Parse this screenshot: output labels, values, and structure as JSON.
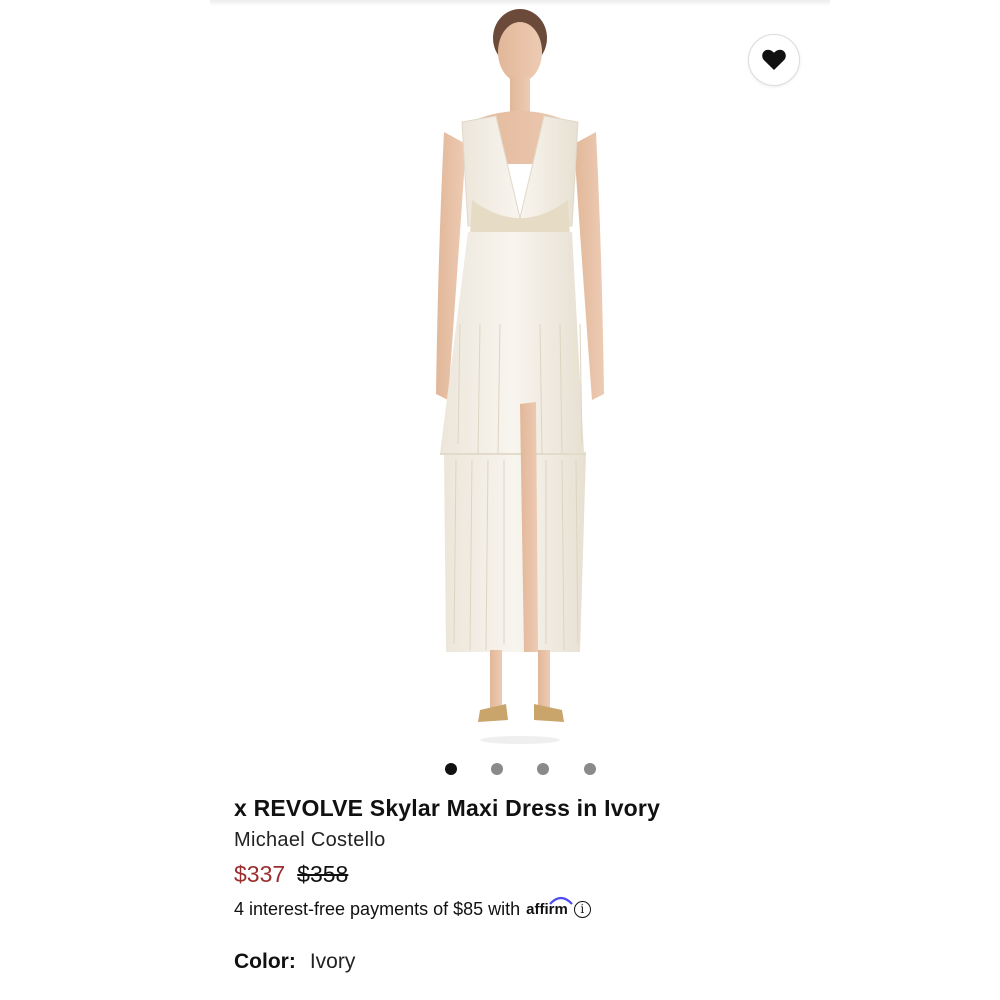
{
  "product": {
    "title": "x REVOLVE Skylar Maxi Dress in Ivory",
    "brand": "Michael Costello",
    "price_sale": "$337",
    "price_original": "$358",
    "installments_text": "4 interest-free payments of $85 with",
    "affirm_label": "affirm",
    "info_icon": "i",
    "color_label": "Color:",
    "color_value": "Ivory"
  },
  "carousel": {
    "total": 4,
    "active_index": 0
  },
  "icons": {
    "wishlist": "heart-icon",
    "info": "info-icon"
  },
  "colors": {
    "sale_price": "#9b2d2d",
    "text": "#111111",
    "dot_active": "#111111",
    "dot_inactive": "#8a8a8a"
  }
}
